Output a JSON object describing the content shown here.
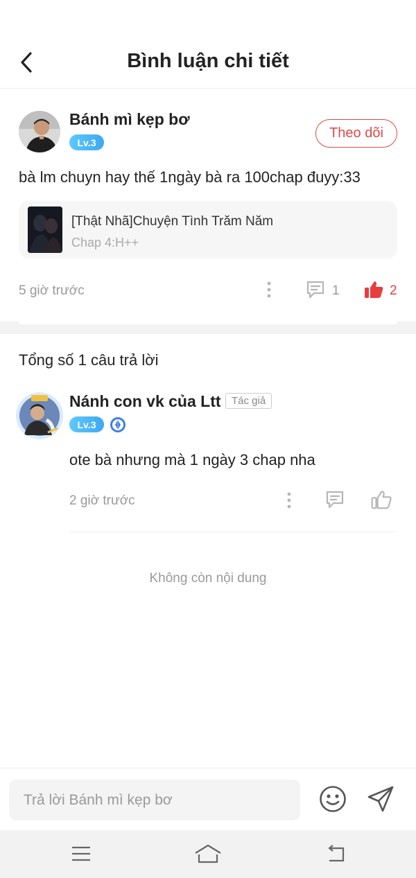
{
  "header": {
    "title": "Bình luận chi tiết"
  },
  "main_comment": {
    "user_name": "Bánh mì kẹp bơ",
    "level": "Lv.3",
    "follow_label": "Theo dõi",
    "text": "bà lm chuyn hay thế 1ngày bà ra 100chap đuyy:33",
    "chapter": {
      "title": "[Thật Nhã]Chuyện Tình Trăm Năm",
      "subtitle": "Chap 4:H++"
    },
    "time": "5 giờ trước",
    "reply_count": "1",
    "like_count": "2",
    "like_color": "#e83e3e"
  },
  "replies_section": {
    "total_label": "Tổng số 1 câu trả lời",
    "replies": [
      {
        "user_name": "Nánh con vk của Ltt",
        "author_tag": "Tác giả",
        "level": "Lv.3",
        "text": "ote bà nhưng mà 1 ngày 3 chap nha",
        "time": "2 giờ trước"
      }
    ],
    "end_label": "Không còn nội dung"
  },
  "input_bar": {
    "placeholder": "Trả lời Bánh mì kẹp bơ"
  },
  "icons": {
    "back": "chevron-left-icon",
    "more": "more-vertical-icon",
    "comment": "comment-icon",
    "like": "thumbs-up-icon",
    "emoji": "smiley-icon",
    "send": "send-icon"
  },
  "colors": {
    "accent": "#e04848",
    "level_badge": "#3ea8f0"
  }
}
